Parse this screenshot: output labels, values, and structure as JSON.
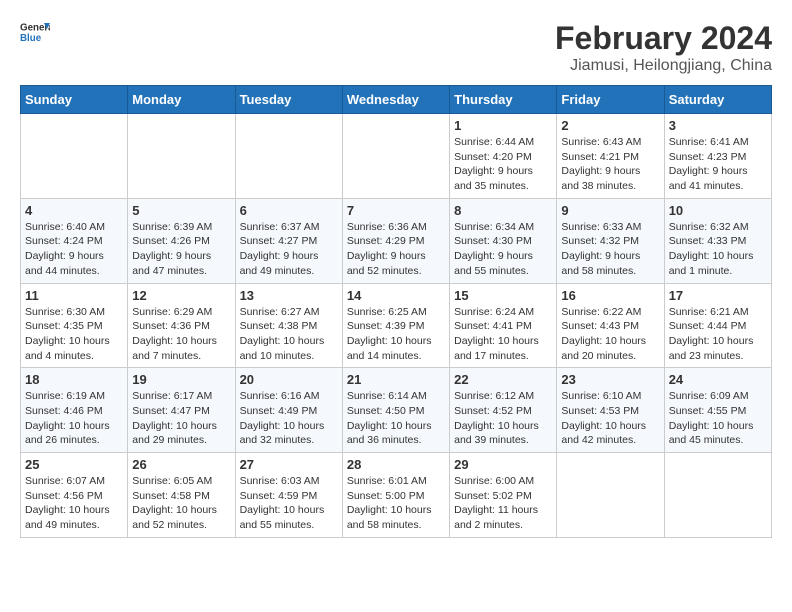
{
  "header": {
    "logo_text_general": "General",
    "logo_text_blue": "Blue",
    "month_year": "February 2024",
    "location": "Jiamusi, Heilongjiang, China"
  },
  "columns": [
    "Sunday",
    "Monday",
    "Tuesday",
    "Wednesday",
    "Thursday",
    "Friday",
    "Saturday"
  ],
  "weeks": [
    [
      {
        "day": "",
        "info": ""
      },
      {
        "day": "",
        "info": ""
      },
      {
        "day": "",
        "info": ""
      },
      {
        "day": "",
        "info": ""
      },
      {
        "day": "1",
        "info": "Sunrise: 6:44 AM\nSunset: 4:20 PM\nDaylight: 9 hours and 35 minutes."
      },
      {
        "day": "2",
        "info": "Sunrise: 6:43 AM\nSunset: 4:21 PM\nDaylight: 9 hours and 38 minutes."
      },
      {
        "day": "3",
        "info": "Sunrise: 6:41 AM\nSunset: 4:23 PM\nDaylight: 9 hours and 41 minutes."
      }
    ],
    [
      {
        "day": "4",
        "info": "Sunrise: 6:40 AM\nSunset: 4:24 PM\nDaylight: 9 hours and 44 minutes."
      },
      {
        "day": "5",
        "info": "Sunrise: 6:39 AM\nSunset: 4:26 PM\nDaylight: 9 hours and 47 minutes."
      },
      {
        "day": "6",
        "info": "Sunrise: 6:37 AM\nSunset: 4:27 PM\nDaylight: 9 hours and 49 minutes."
      },
      {
        "day": "7",
        "info": "Sunrise: 6:36 AM\nSunset: 4:29 PM\nDaylight: 9 hours and 52 minutes."
      },
      {
        "day": "8",
        "info": "Sunrise: 6:34 AM\nSunset: 4:30 PM\nDaylight: 9 hours and 55 minutes."
      },
      {
        "day": "9",
        "info": "Sunrise: 6:33 AM\nSunset: 4:32 PM\nDaylight: 9 hours and 58 minutes."
      },
      {
        "day": "10",
        "info": "Sunrise: 6:32 AM\nSunset: 4:33 PM\nDaylight: 10 hours and 1 minute."
      }
    ],
    [
      {
        "day": "11",
        "info": "Sunrise: 6:30 AM\nSunset: 4:35 PM\nDaylight: 10 hours and 4 minutes."
      },
      {
        "day": "12",
        "info": "Sunrise: 6:29 AM\nSunset: 4:36 PM\nDaylight: 10 hours and 7 minutes."
      },
      {
        "day": "13",
        "info": "Sunrise: 6:27 AM\nSunset: 4:38 PM\nDaylight: 10 hours and 10 minutes."
      },
      {
        "day": "14",
        "info": "Sunrise: 6:25 AM\nSunset: 4:39 PM\nDaylight: 10 hours and 14 minutes."
      },
      {
        "day": "15",
        "info": "Sunrise: 6:24 AM\nSunset: 4:41 PM\nDaylight: 10 hours and 17 minutes."
      },
      {
        "day": "16",
        "info": "Sunrise: 6:22 AM\nSunset: 4:43 PM\nDaylight: 10 hours and 20 minutes."
      },
      {
        "day": "17",
        "info": "Sunrise: 6:21 AM\nSunset: 4:44 PM\nDaylight: 10 hours and 23 minutes."
      }
    ],
    [
      {
        "day": "18",
        "info": "Sunrise: 6:19 AM\nSunset: 4:46 PM\nDaylight: 10 hours and 26 minutes."
      },
      {
        "day": "19",
        "info": "Sunrise: 6:17 AM\nSunset: 4:47 PM\nDaylight: 10 hours and 29 minutes."
      },
      {
        "day": "20",
        "info": "Sunrise: 6:16 AM\nSunset: 4:49 PM\nDaylight: 10 hours and 32 minutes."
      },
      {
        "day": "21",
        "info": "Sunrise: 6:14 AM\nSunset: 4:50 PM\nDaylight: 10 hours and 36 minutes."
      },
      {
        "day": "22",
        "info": "Sunrise: 6:12 AM\nSunset: 4:52 PM\nDaylight: 10 hours and 39 minutes."
      },
      {
        "day": "23",
        "info": "Sunrise: 6:10 AM\nSunset: 4:53 PM\nDaylight: 10 hours and 42 minutes."
      },
      {
        "day": "24",
        "info": "Sunrise: 6:09 AM\nSunset: 4:55 PM\nDaylight: 10 hours and 45 minutes."
      }
    ],
    [
      {
        "day": "25",
        "info": "Sunrise: 6:07 AM\nSunset: 4:56 PM\nDaylight: 10 hours and 49 minutes."
      },
      {
        "day": "26",
        "info": "Sunrise: 6:05 AM\nSunset: 4:58 PM\nDaylight: 10 hours and 52 minutes."
      },
      {
        "day": "27",
        "info": "Sunrise: 6:03 AM\nSunset: 4:59 PM\nDaylight: 10 hours and 55 minutes."
      },
      {
        "day": "28",
        "info": "Sunrise: 6:01 AM\nSunset: 5:00 PM\nDaylight: 10 hours and 58 minutes."
      },
      {
        "day": "29",
        "info": "Sunrise: 6:00 AM\nSunset: 5:02 PM\nDaylight: 11 hours and 2 minutes."
      },
      {
        "day": "",
        "info": ""
      },
      {
        "day": "",
        "info": ""
      }
    ]
  ]
}
